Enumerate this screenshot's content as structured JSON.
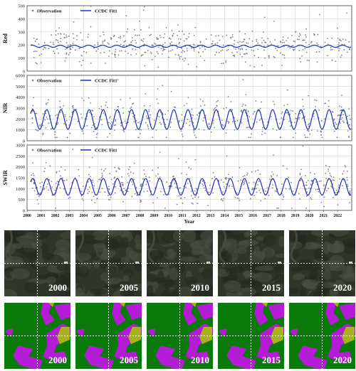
{
  "chart_data": [
    {
      "type": "scatter",
      "ylabel": "Red",
      "ylim": [
        0,
        500
      ],
      "yticks": [
        0,
        100,
        200,
        300,
        400,
        500
      ],
      "xlim": [
        2000,
        2023
      ],
      "grid": true,
      "legend_position": "top-left",
      "series": [
        {
          "name": "Observation",
          "style": "gray dots",
          "color": "#7f7f7f"
        },
        {
          "name": "CCDC Fit1",
          "style": "blue line",
          "color": "#1f2fbf",
          "model": {
            "mean": 190,
            "amplitude": 8,
            "cycles_per_year": 1,
            "phase": 0.1
          }
        }
      ],
      "observations_note_x_start": 2000.3,
      "observations_count_approx": 500,
      "observation_range": [
        30,
        495
      ]
    },
    {
      "type": "scatter",
      "ylabel": "NIR",
      "ylim": [
        0,
        6000
      ],
      "yticks": [
        0,
        1000,
        2000,
        3000,
        4000,
        5000,
        6000
      ],
      "xlim": [
        2000,
        2023
      ],
      "grid": true,
      "legend_position": "top-left",
      "series": [
        {
          "name": "Observation",
          "style": "gray dots",
          "color": "#7f7f7f"
        },
        {
          "name": "CCDC Fit1",
          "style": "blue line",
          "color": "#1f2fbf",
          "model": {
            "mean": 1950,
            "amplitude": 900,
            "cycles_per_year": 1,
            "phase": 0.15
          }
        }
      ],
      "observations_count_approx": 500,
      "observation_range": [
        300,
        5600
      ]
    },
    {
      "type": "scatter",
      "ylabel": "SWIR",
      "xlabel": "Year",
      "ylim": [
        0,
        3000
      ],
      "yticks": [
        0,
        500,
        1000,
        1500,
        2000,
        2500,
        3000
      ],
      "xlim": [
        2000,
        2023
      ],
      "xticks": [
        "2000",
        "2001",
        "2002",
        "2003",
        "2004",
        "2005",
        "2006",
        "2007",
        "2008",
        "2009",
        "2010",
        "2011",
        "2012",
        "2013",
        "2014",
        "2015",
        "2016",
        "2017",
        "2018",
        "2019",
        "2020",
        "2021",
        "2022"
      ],
      "grid": true,
      "legend_position": "top-left",
      "series": [
        {
          "name": "Observation",
          "style": "gray dots",
          "color": "#7f7f7f"
        },
        {
          "name": "CCDC Fit1",
          "style": "blue line",
          "color": "#1f2fbf",
          "model": {
            "mean": 1080,
            "amplitude": 380,
            "cycles_per_year": 1,
            "phase": 0.15
          }
        }
      ],
      "observations_count_approx": 500,
      "observation_range": [
        100,
        2950
      ]
    }
  ],
  "image_panels": {
    "years": [
      "2000",
      "2005",
      "2010",
      "2015",
      "2020"
    ],
    "rows": [
      {
        "kind": "satellite",
        "colors": {
          "base": "#2f3528",
          "dark": "#232820",
          "light": "#4a5045",
          "bright": "#cfd3cf"
        }
      },
      {
        "kind": "classification",
        "colors": {
          "forest": "#0a7a0a",
          "class_purple": "#b41cd6",
          "class_yellow": "#a8b21a"
        }
      }
    ],
    "crosshair_color": "#ffffff"
  }
}
